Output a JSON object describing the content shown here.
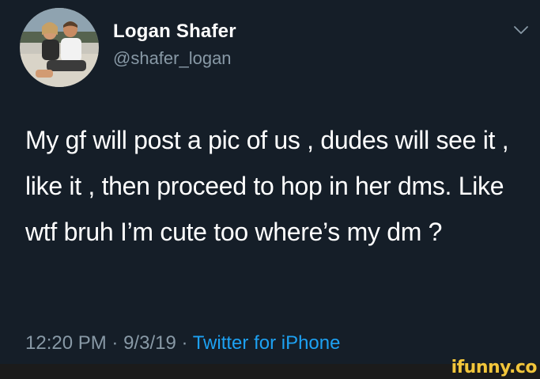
{
  "tweet": {
    "author_name": "Logan Shafer",
    "author_handle": "@shafer_logan",
    "text": "My gf will post a pic of us , dudes will see it , like it , then proceed to hop in her dms. Like wtf bruh I’m cute too where’s my dm ?",
    "time": "12:20 PM",
    "separator": "·",
    "date": "9/3/19",
    "source": "Twitter for iPhone"
  },
  "watermark": {
    "text": "ifunny.co",
    "color": "#f2c63b"
  },
  "colors": {
    "background": "#151e28",
    "primary_text": "#ffffff",
    "secondary_text": "#8899a6",
    "link": "#1da1f2"
  }
}
